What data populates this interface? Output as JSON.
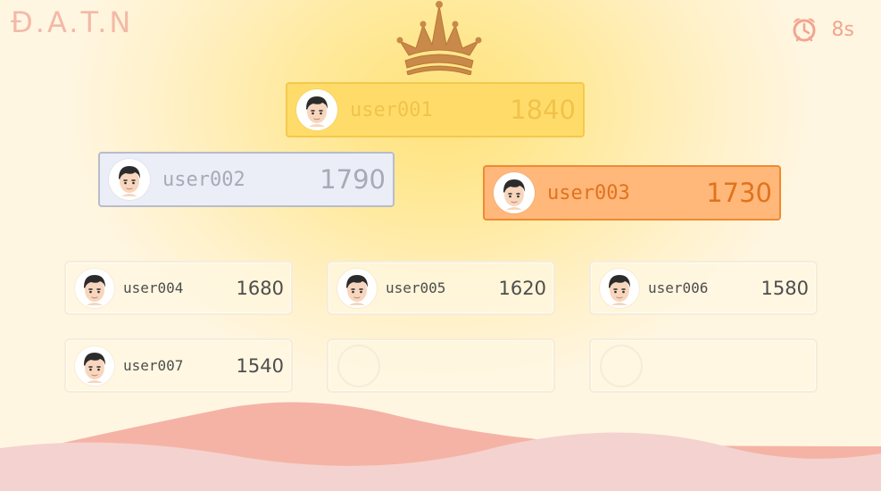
{
  "header": {
    "logo_text": "Đ.A.T.N",
    "timer_text": "8s",
    "timer_icon": "alarm-clock-icon"
  },
  "crown_icon": "crown-icon",
  "podium": [
    {
      "rank": 1,
      "name": "user001",
      "score": "1840",
      "color": "#ffdc6a"
    },
    {
      "rank": 2,
      "name": "user002",
      "score": "1790",
      "color": "#eceef7"
    },
    {
      "rank": 3,
      "name": "user003",
      "score": "1730",
      "color": "#ffb77a"
    }
  ],
  "leaderboard": [
    {
      "name": "user004",
      "score": "1680"
    },
    {
      "name": "user005",
      "score": "1620"
    },
    {
      "name": "user006",
      "score": "1580"
    },
    {
      "name": "user007",
      "score": "1540"
    },
    {
      "name": "",
      "score": ""
    },
    {
      "name": "",
      "score": ""
    }
  ],
  "colors": {
    "gold": "#f4c84e",
    "silver": "#b8bccb",
    "bronze": "#ef8a32",
    "accent": "#f3b9a7"
  }
}
